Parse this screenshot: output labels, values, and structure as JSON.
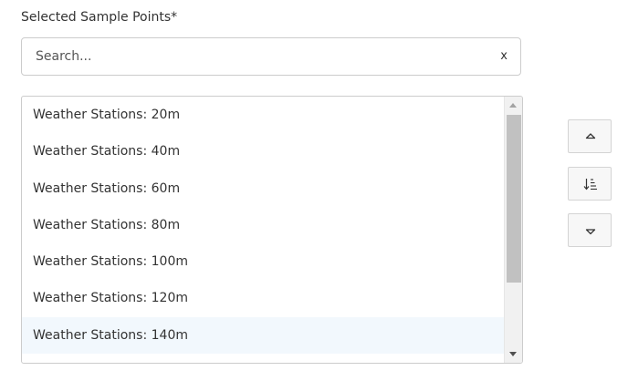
{
  "field": {
    "label": "Selected Sample Points*"
  },
  "search": {
    "placeholder": "Search...",
    "value": "",
    "clear_label": "x"
  },
  "list": {
    "items": [
      {
        "label": "Weather Stations: 20m"
      },
      {
        "label": "Weather Stations: 40m"
      },
      {
        "label": "Weather Stations: 60m"
      },
      {
        "label": "Weather Stations: 80m"
      },
      {
        "label": "Weather Stations: 100m"
      },
      {
        "label": "Weather Stations: 120m"
      },
      {
        "label": "Weather Stations: 140m"
      }
    ],
    "hovered_index": 6
  },
  "scrollbar": {
    "position_fraction": 0.0,
    "visible_fraction": 0.68
  },
  "side_buttons": [
    {
      "icon": "caret-up-icon"
    },
    {
      "icon": "sort-descending-icon"
    },
    {
      "icon": "caret-down-icon"
    }
  ],
  "colors": {
    "border": "#cccccc",
    "text": "#333333",
    "hover_row": "#f2f8fd",
    "scroll_track": "#f1f1f1",
    "scroll_thumb": "#c1c1c1",
    "button_bg": "#f7f7f7"
  }
}
